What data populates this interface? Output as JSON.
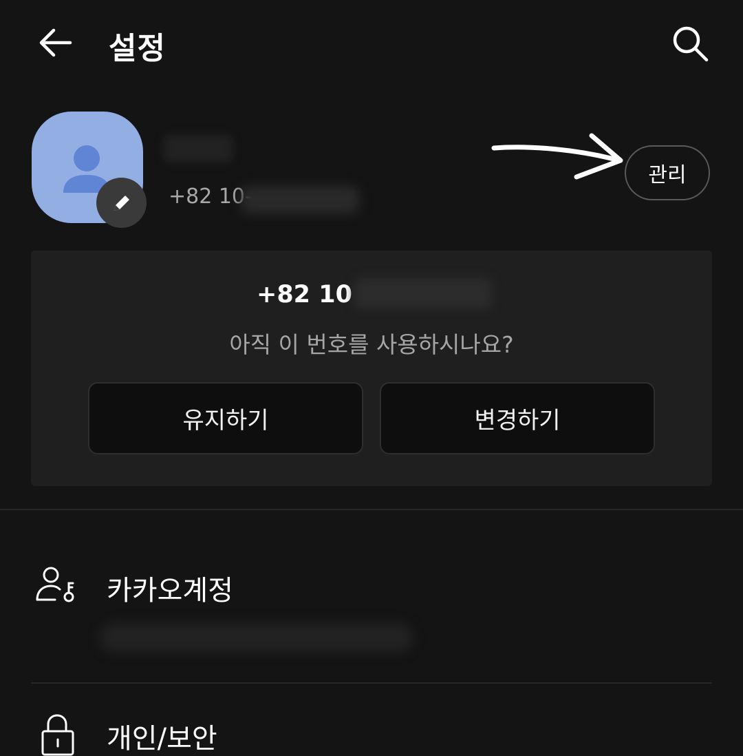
{
  "header": {
    "title": "설정",
    "back_icon": "arrow-left-icon",
    "search_icon": "search-icon"
  },
  "profile": {
    "phone_prefix": "+82 10-",
    "manage_label": "관리",
    "avatar_color": "#93aee3"
  },
  "number_card": {
    "number_prefix": "+82 10",
    "question": "아직 이 번호를 사용하시나요?",
    "keep_label": "유지하기",
    "change_label": "변경하기"
  },
  "settings_list": [
    {
      "label": "카카오계정",
      "icon": "account-key-icon"
    },
    {
      "label": "개인/보안",
      "icon": "lock-icon"
    }
  ],
  "colors": {
    "background": "#141414",
    "card": "#1f1f1f",
    "text_secondary": "#a6a6a6"
  }
}
